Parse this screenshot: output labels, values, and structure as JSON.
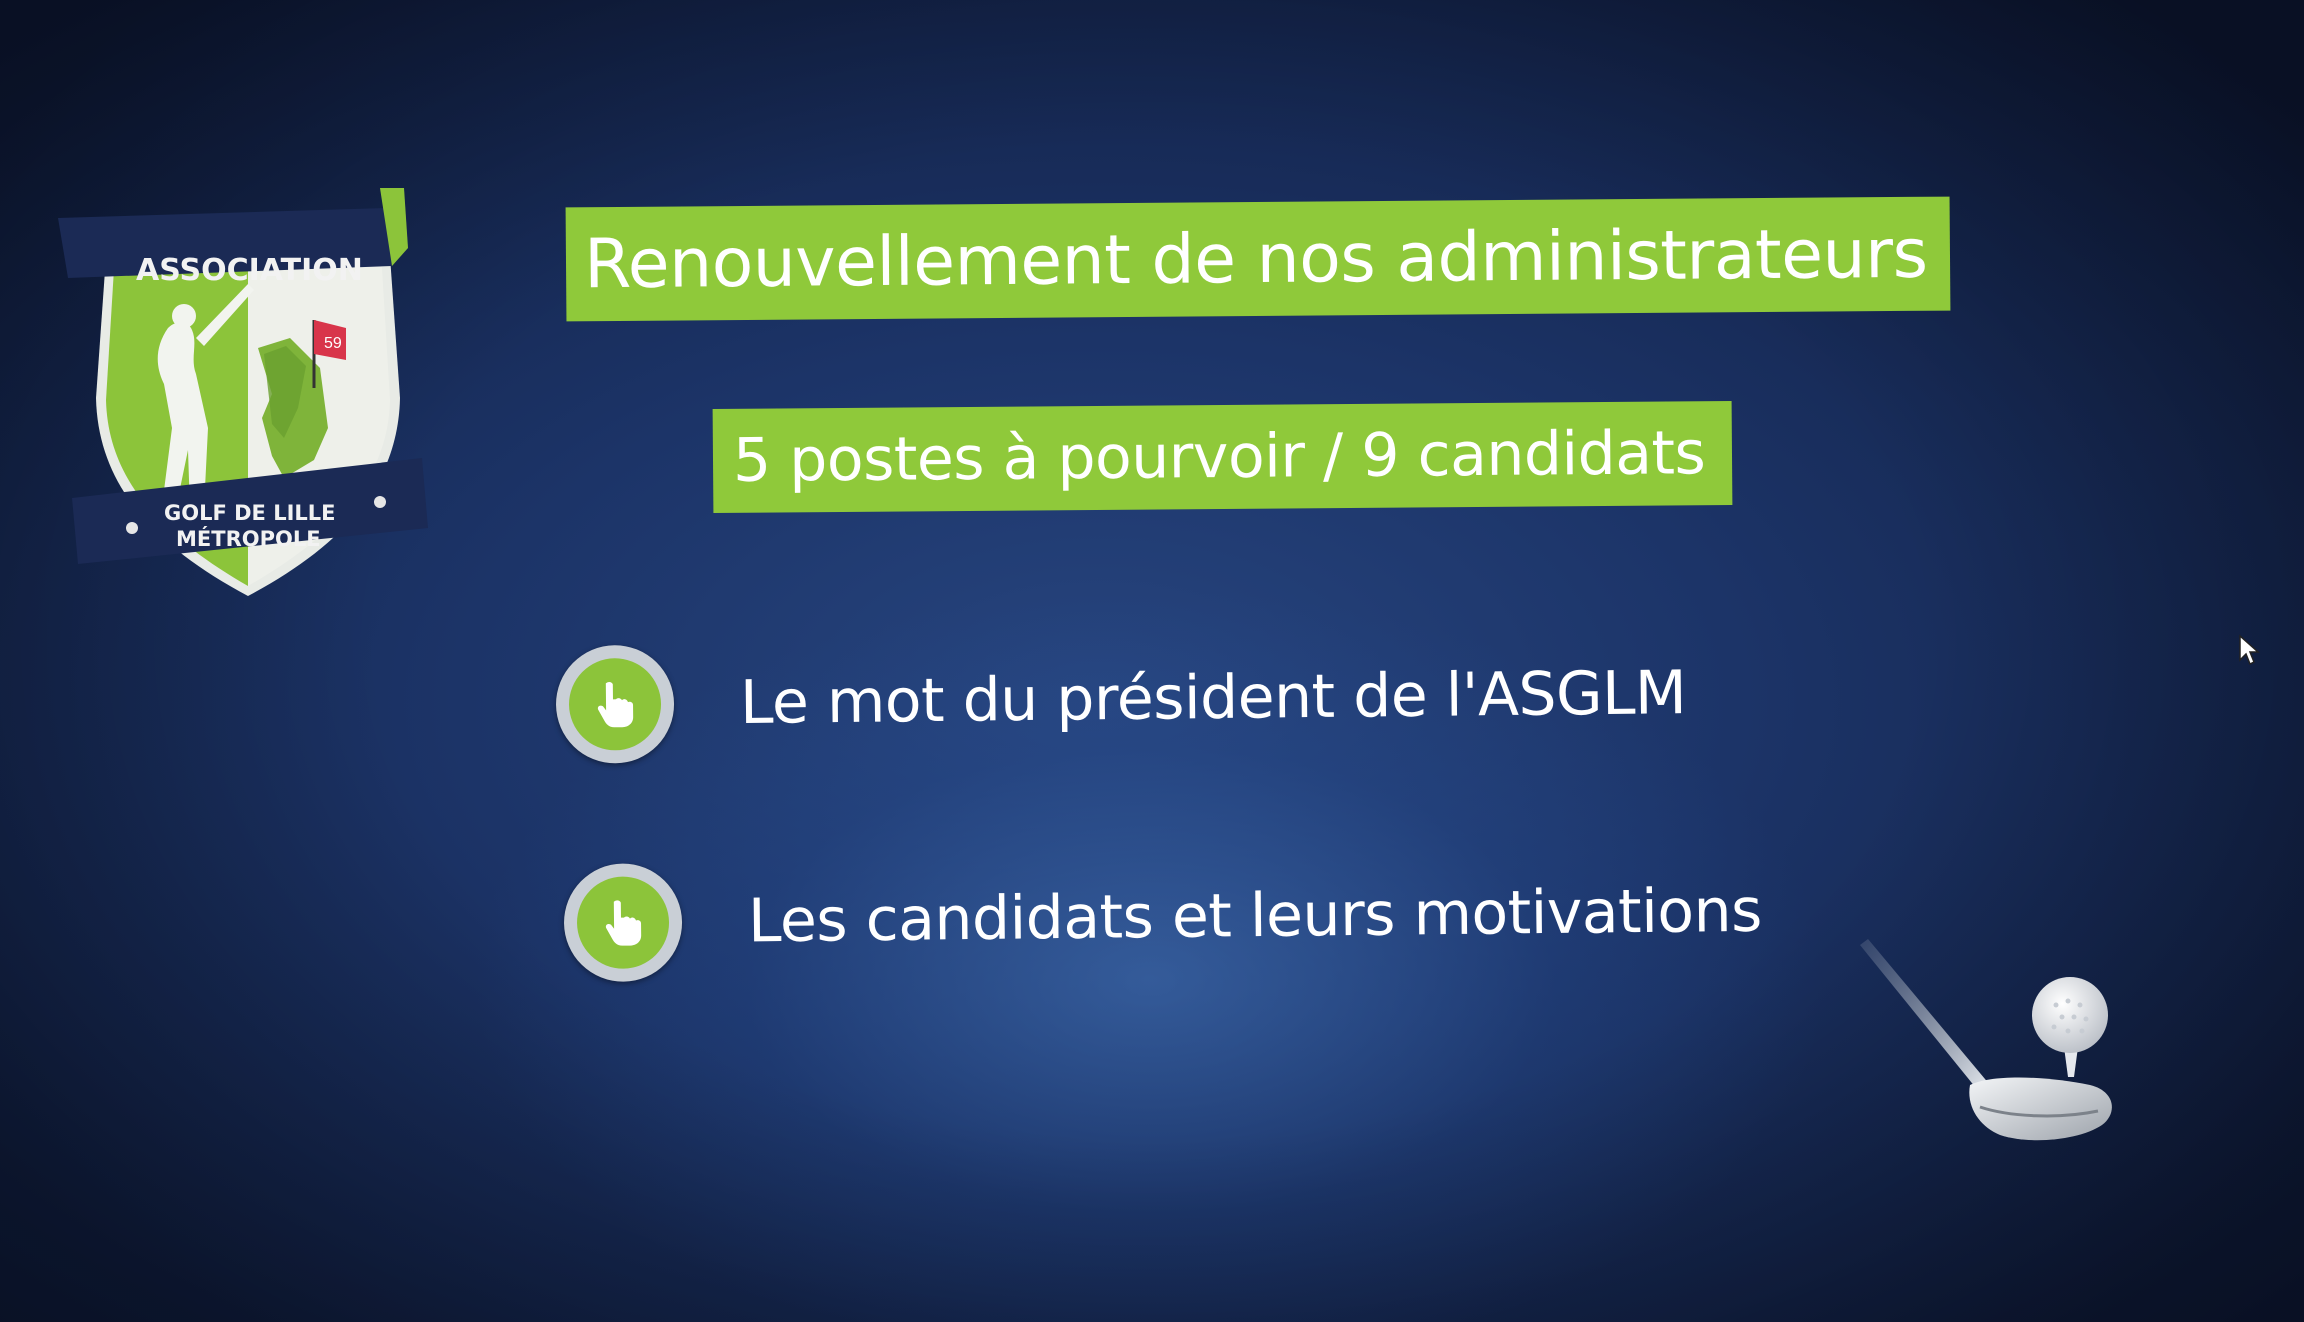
{
  "logo": {
    "top_text": "ASSOCIATION",
    "bottom_line1": "GOLF DE LILLE",
    "bottom_line2": "MÉTROPOLE",
    "badge_number": "59",
    "colors": {
      "green": "#8cc43a",
      "navy": "#1b2a55",
      "white": "#f2f2f2",
      "flag_red": "#d8354a"
    }
  },
  "title": "Renouvellement de nos administrateurs",
  "subtitle": "5 postes à pourvoir / 9 candidats",
  "menu": [
    {
      "label": "Le mot du président de l'ASGLM",
      "icon": "pointer-hand-icon"
    },
    {
      "label": "Les candidats et leurs motivations",
      "icon": "pointer-hand-icon"
    }
  ],
  "decorations": {
    "golf_club": "golf-club-icon",
    "golf_ball": "golf-ball-icon",
    "cursor": "mouse-cursor-icon"
  },
  "colors": {
    "accent_green": "#8fc93a",
    "background_blue": "#1c3468",
    "text": "#ffffff"
  }
}
